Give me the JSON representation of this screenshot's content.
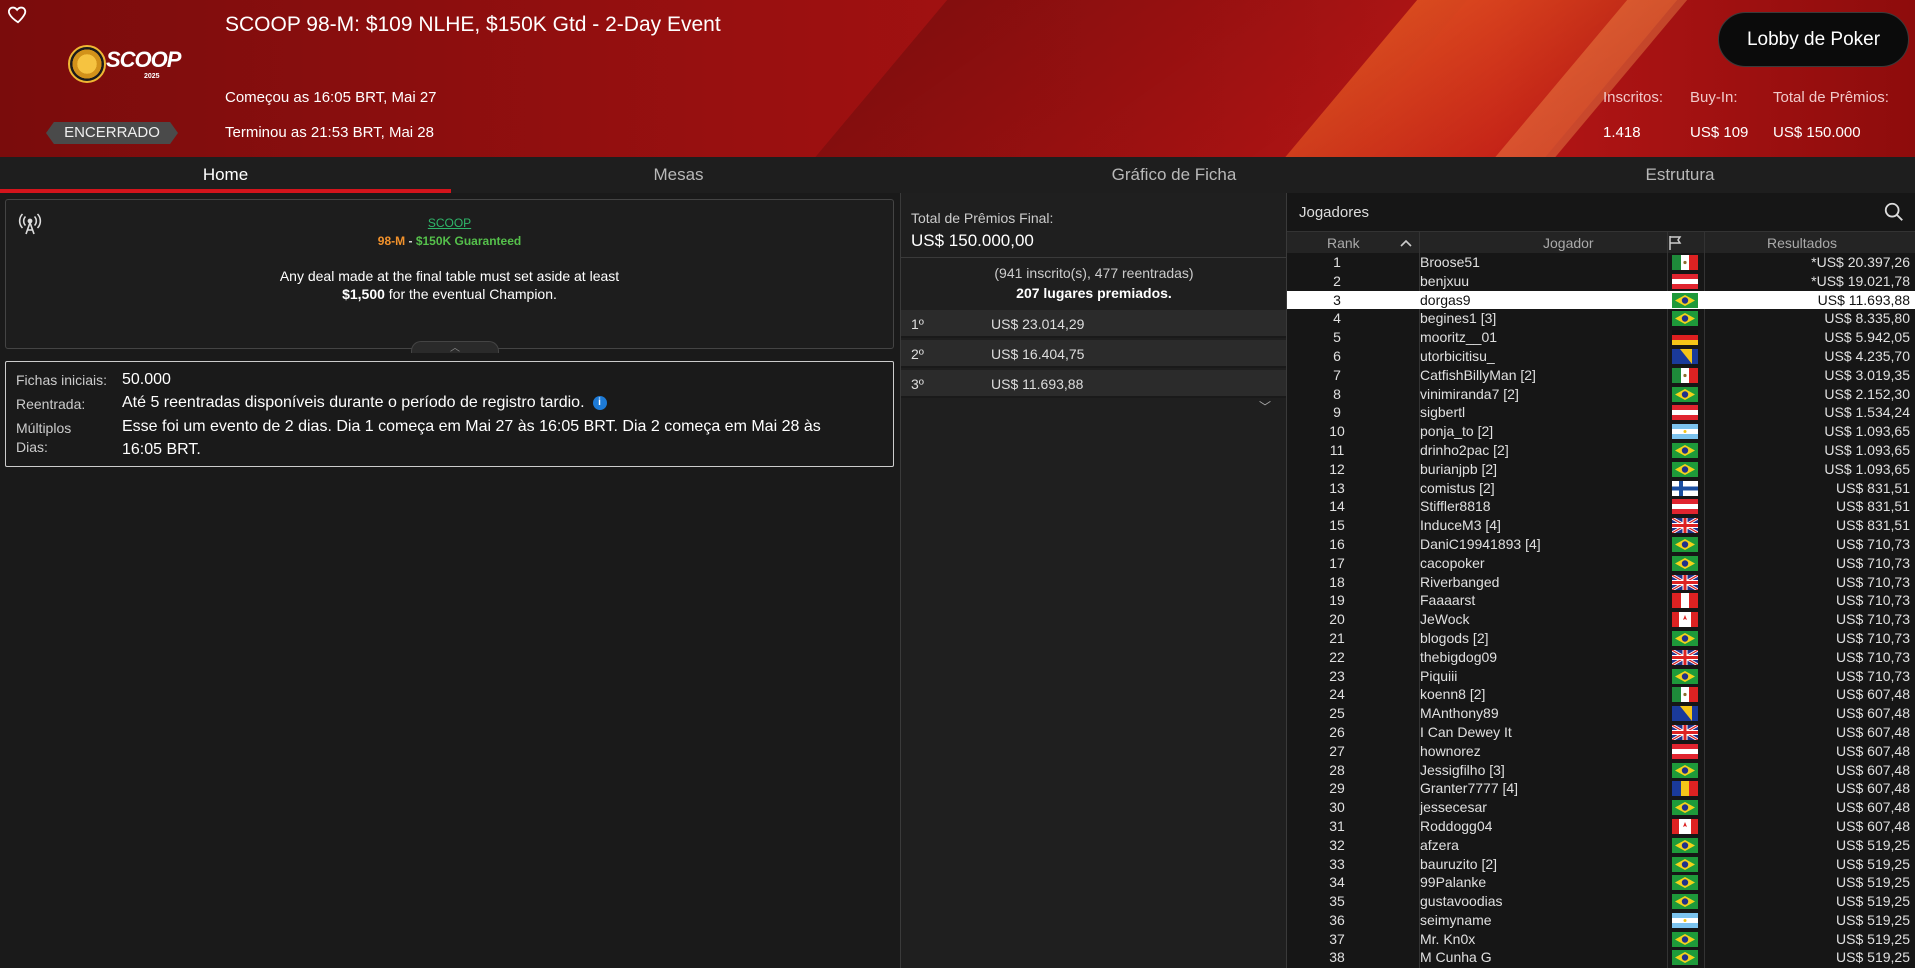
{
  "header": {
    "title": "SCOOP 98-M: $109 NLHE, $150K Gtd - 2-Day Event",
    "started": "Começou as 16:05 BRT, Mai 27",
    "ended": "Terminou as 21:53 BRT, Mai 28",
    "status": "ENCERRADO",
    "logo_text": "SCOOP",
    "logo_year": "2025",
    "lobby_button": "Lobby de Poker",
    "stats": {
      "entrants_label": "Inscritos:",
      "entrants": "1.418",
      "buyin_label": "Buy-In:",
      "buyin": "US$ 109",
      "prize_label": "Total de Prêmios:",
      "prize": "US$ 150.000"
    }
  },
  "tabs": [
    "Home",
    "Mesas",
    "Gráfico de Ficha",
    "Estrutura"
  ],
  "info": {
    "link": "SCOOP",
    "sub_event": "98-M",
    "sub_sep": " - ",
    "sub_gtd": "$150K Guaranteed",
    "line1": "Any deal made at the final table must set aside at least",
    "line2_bold": "$1,500",
    "line2_rest": " for the eventual Champion."
  },
  "details": {
    "stack_label": "Fichas iniciais:",
    "stack": "50.000",
    "reentry_label": "Reentrada:",
    "reentry": "Até 5 reentradas disponíveis durante o período de registro tardio.",
    "multi_label1": "Múltiplos",
    "multi_label2": "Dias:",
    "multi_line1": "Esse foi um evento de 2 dias. Dia 1 começa em Mai 27 às 16:05 BRT. Dia 2 começa em Mai 28 às",
    "multi_line2": "16:05 BRT."
  },
  "prizes": {
    "final_label": "Total de Prêmios Final:",
    "final_value": "US$ 150.000,00",
    "entrants": "(941 inscrito(s), 477 reentradas)",
    "paid": "207 lugares premiados.",
    "places": [
      {
        "place": "1º",
        "amount": "US$ 23.014,29"
      },
      {
        "place": "2º",
        "amount": "US$ 16.404,75"
      },
      {
        "place": "3º",
        "amount": "US$ 11.693,88"
      }
    ]
  },
  "players": {
    "title": "Jogadores",
    "columns": {
      "rank": "Rank",
      "player": "Jogador",
      "results": "Resultados"
    },
    "rows": [
      {
        "rank": "1",
        "name": "Broose51",
        "flag": "mx",
        "result": "*US$ 20.397,26"
      },
      {
        "rank": "2",
        "name": "benjxuu",
        "flag": "at",
        "result": "*US$ 19.021,78"
      },
      {
        "rank": "3",
        "name": "dorgas9",
        "flag": "br",
        "result": "US$ 11.693,88",
        "selected": true
      },
      {
        "rank": "4",
        "name": "begines1 [3]",
        "flag": "br",
        "result": "US$ 8.335,80"
      },
      {
        "rank": "5",
        "name": "mooritz__01",
        "flag": "de",
        "result": "US$ 5.942,05"
      },
      {
        "rank": "6",
        "name": "utorbicitisu_",
        "flag": "ba",
        "result": "US$ 4.235,70"
      },
      {
        "rank": "7",
        "name": "CatfishBillyMan [2]",
        "flag": "mx",
        "result": "US$ 3.019,35"
      },
      {
        "rank": "8",
        "name": "vinimiranda7 [2]",
        "flag": "br",
        "result": "US$ 2.152,30"
      },
      {
        "rank": "9",
        "name": "sigbertl",
        "flag": "at",
        "result": "US$ 1.534,24"
      },
      {
        "rank": "10",
        "name": "ponja_to [2]",
        "flag": "ar",
        "result": "US$ 1.093,65"
      },
      {
        "rank": "11",
        "name": "drinho2pac [2]",
        "flag": "br",
        "result": "US$ 1.093,65"
      },
      {
        "rank": "12",
        "name": "burianjpb [2]",
        "flag": "br",
        "result": "US$ 1.093,65"
      },
      {
        "rank": "13",
        "name": "comistus [2]",
        "flag": "fi",
        "result": "US$ 831,51"
      },
      {
        "rank": "14",
        "name": "Stiffler8818",
        "flag": "at",
        "result": "US$ 831,51"
      },
      {
        "rank": "15",
        "name": "InduceM3 [4]",
        "flag": "gb",
        "result": "US$ 831,51"
      },
      {
        "rank": "16",
        "name": "DaniC19941893 [4]",
        "flag": "br",
        "result": "US$ 710,73"
      },
      {
        "rank": "17",
        "name": "cacopoker",
        "flag": "br",
        "result": "US$ 710,73"
      },
      {
        "rank": "18",
        "name": "Riverbanged",
        "flag": "gb",
        "result": "US$ 710,73"
      },
      {
        "rank": "19",
        "name": "Faaaarst",
        "flag": "pe",
        "result": "US$ 710,73"
      },
      {
        "rank": "20",
        "name": "JeWock",
        "flag": "ca",
        "result": "US$ 710,73"
      },
      {
        "rank": "21",
        "name": "blogods [2]",
        "flag": "br",
        "result": "US$ 710,73"
      },
      {
        "rank": "22",
        "name": "thebigdog09",
        "flag": "gb",
        "result": "US$ 710,73"
      },
      {
        "rank": "23",
        "name": "Piquiii",
        "flag": "br",
        "result": "US$ 710,73"
      },
      {
        "rank": "24",
        "name": "koenn8 [2]",
        "flag": "mx",
        "result": "US$ 607,48"
      },
      {
        "rank": "25",
        "name": "MAnthony89",
        "flag": "ba",
        "result": "US$ 607,48"
      },
      {
        "rank": "26",
        "name": "I Can Dewey It",
        "flag": "gb",
        "result": "US$ 607,48"
      },
      {
        "rank": "27",
        "name": "hownorez",
        "flag": "at",
        "result": "US$ 607,48"
      },
      {
        "rank": "28",
        "name": "Jessigfilho [3]",
        "flag": "br",
        "result": "US$ 607,48"
      },
      {
        "rank": "29",
        "name": "Granter7777 [4]",
        "flag": "md",
        "result": "US$ 607,48"
      },
      {
        "rank": "30",
        "name": "jessecesar",
        "flag": "br",
        "result": "US$ 607,48"
      },
      {
        "rank": "31",
        "name": "Roddogg04",
        "flag": "ca",
        "result": "US$ 607,48"
      },
      {
        "rank": "32",
        "name": "afzera",
        "flag": "br",
        "result": "US$ 519,25"
      },
      {
        "rank": "33",
        "name": "bauruzito [2]",
        "flag": "br",
        "result": "US$ 519,25"
      },
      {
        "rank": "34",
        "name": "99Palanke",
        "flag": "br",
        "result": "US$ 519,25"
      },
      {
        "rank": "35",
        "name": "gustavoodias",
        "flag": "br",
        "result": "US$ 519,25"
      },
      {
        "rank": "36",
        "name": "seimyname",
        "flag": "ar",
        "result": "US$ 519,25"
      },
      {
        "rank": "37",
        "name": "Mr. Kn0x",
        "flag": "br",
        "result": "US$ 519,25"
      },
      {
        "rank": "38",
        "name": "M Cunha G",
        "flag": "br",
        "result": "US$ 519,25"
      }
    ]
  },
  "colors": {
    "accent_red": "#d3141c",
    "header_red": "#a81212",
    "link_green": "#2fb66a",
    "event_orange": "#f2922c",
    "gtd_green": "#55c04b",
    "info_blue": "#1d7ad6"
  },
  "icons": {
    "favorite": "heart-outline-icon",
    "antenna": "broadcast-icon",
    "search": "search-icon",
    "flag_header": "flag-icon",
    "sort": "sort-ascending-icon",
    "collapse": "chevron-up-icon",
    "expand": "chevron-down-icon"
  }
}
